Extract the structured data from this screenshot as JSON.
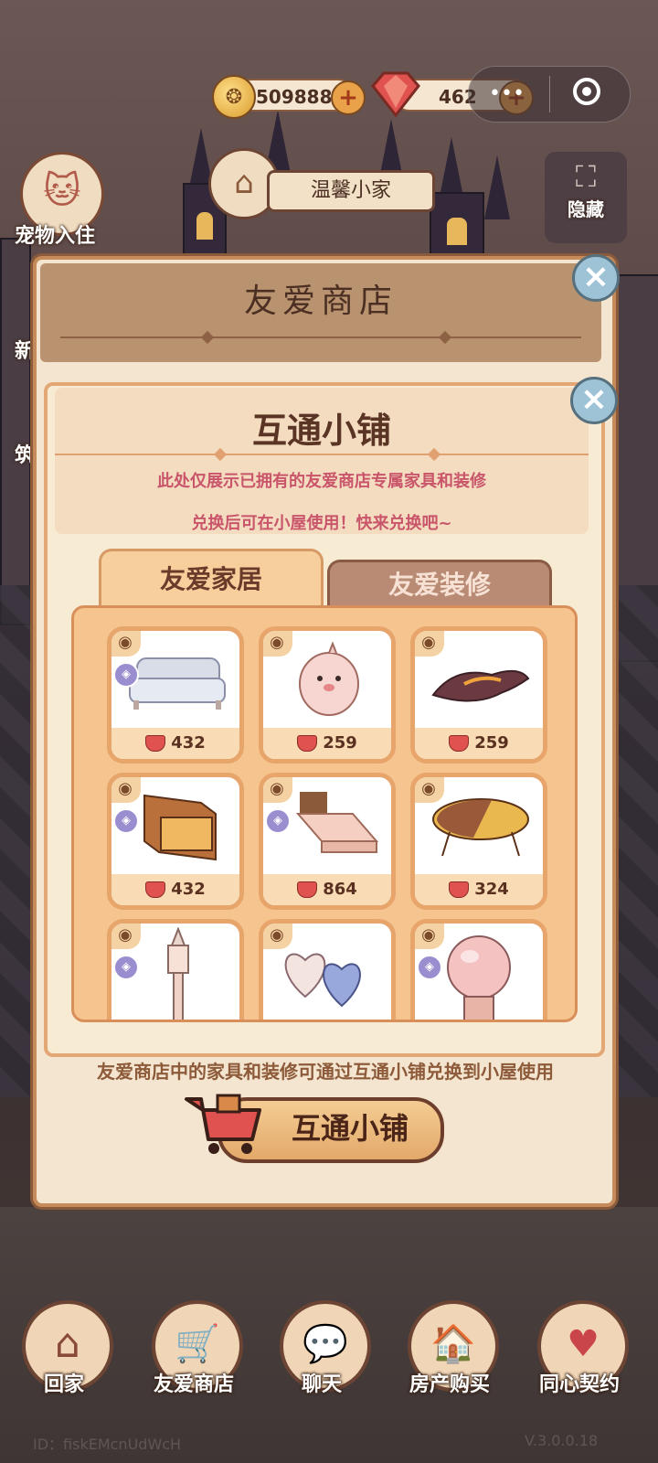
{
  "top_bar": {
    "coins": "509888",
    "gems": "462"
  },
  "side": {
    "pet_label": "宠物入住",
    "new_label": "新",
    "left_label_2": "筑",
    "hide_label": "隐藏"
  },
  "house_sign": "温馨小家",
  "outer_panel": {
    "title": "友爱商店"
  },
  "inner_panel": {
    "title": "互通小铺",
    "notice_1": "此处仅展示已拥有的友爱商店专属家具和装修",
    "notice_2": "兑换后可在小屋使用！快来兑换吧~"
  },
  "tabs": [
    {
      "label": "友爱家居",
      "active": true
    },
    {
      "label": "友爱装修",
      "active": false
    }
  ],
  "items": [
    {
      "name": "sofa",
      "price": "432"
    },
    {
      "name": "plush-creature",
      "price": "259"
    },
    {
      "name": "lava-dragon",
      "price": "259"
    },
    {
      "name": "cabinet",
      "price": "432"
    },
    {
      "name": "bed",
      "price": "864"
    },
    {
      "name": "oval-table",
      "price": "324"
    },
    {
      "name": "lamp-post",
      "price": ""
    },
    {
      "name": "heart-pillows",
      "price": ""
    },
    {
      "name": "crystal-ball",
      "price": ""
    }
  ],
  "footer_hint": "友爱商店中的家具和装修可通过互通小铺兑换到小屋使用",
  "shop_button": "互通小铺",
  "bottom_nav": [
    {
      "label": "回家",
      "icon": "house-icon"
    },
    {
      "label": "友爱商店",
      "icon": "cart-icon"
    },
    {
      "label": "聊天",
      "icon": "chat-icon"
    },
    {
      "label": "房产购买",
      "icon": "property-icon"
    },
    {
      "label": "同心契约",
      "icon": "contract-icon"
    }
  ],
  "user_id": "ID：fiskEMcnUdWcH",
  "version": "V.3.0.0.18",
  "colors": {
    "accent": "#e3a675",
    "gem": "#e0524f",
    "notice": "#c9556a"
  }
}
